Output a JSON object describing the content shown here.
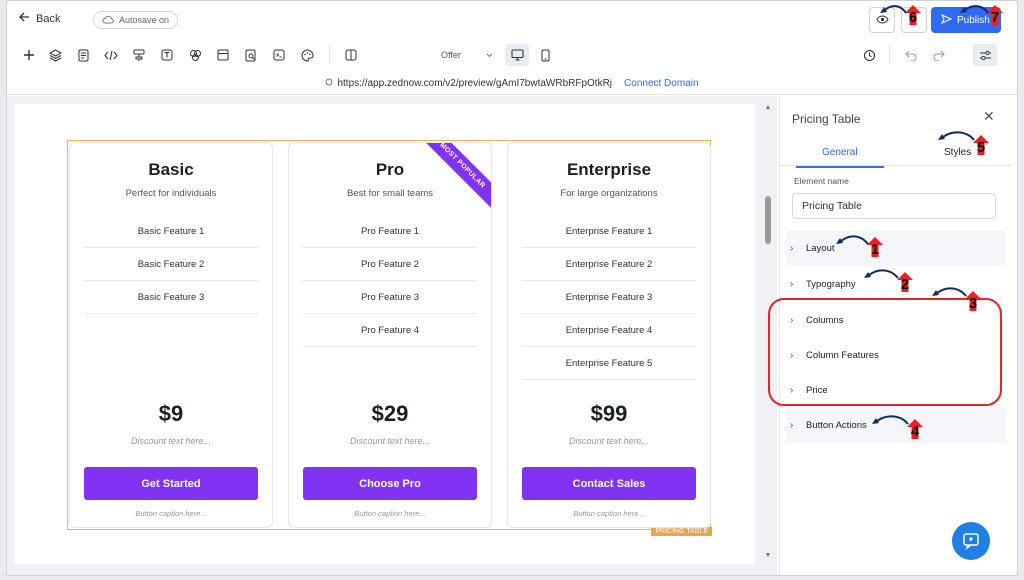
{
  "topbar": {
    "back_label": "Back",
    "autosave_label": "Autosave on",
    "publish_label": "Publish"
  },
  "toolbar": {
    "offer_label": "Offer"
  },
  "urlbar": {
    "url": "https://app.zednow.com/v2/preview/gAmI7bwtaWRbRFpOtkRj",
    "connect_label": "Connect Domain"
  },
  "pricing_table": {
    "badge": "PRICING TABLE",
    "plans": [
      {
        "name": "Basic",
        "subtitle": "Perfect for individuals",
        "features": [
          "Basic Feature 1",
          "Basic Feature 2",
          "Basic Feature 3"
        ],
        "price": "$9",
        "discount": "Discount text here...",
        "button": "Get Started",
        "caption": "Button caption here..."
      },
      {
        "name": "Pro",
        "subtitle": "Best for small teams",
        "ribbon": "MOST POPULAR",
        "features": [
          "Pro Feature 1",
          "Pro Feature 2",
          "Pro Feature 3",
          "Pro Feature 4"
        ],
        "price": "$29",
        "discount": "Discount text here...",
        "button": "Choose Pro",
        "caption": "Button caption here..."
      },
      {
        "name": "Enterprise",
        "subtitle": "For large organizations",
        "features": [
          "Enterprise Feature 1",
          "Enterprise Feature 2",
          "Enterprise Feature 3",
          "Enterprise Feature 4",
          "Enterprise Feature 5"
        ],
        "price": "$99",
        "discount": "Discount text here...",
        "button": "Contact Sales",
        "caption": "Button caption here..."
      }
    ]
  },
  "panel": {
    "title": "Pricing Table",
    "tabs": [
      "General",
      "Styles"
    ],
    "element_name_label": "Element name",
    "element_name_value": "Pricing Table",
    "sections": [
      "Layout",
      "Typography",
      "Columns",
      "Column Features",
      "Price",
      "Button Actions"
    ]
  },
  "annotations": [
    "1",
    "2",
    "3",
    "4",
    "5",
    "6",
    "7"
  ],
  "colors": {
    "accent": "#8133f4",
    "primary": "#2f6bf2",
    "highlight": "#e3242b",
    "table_border": "#e8b35d"
  }
}
